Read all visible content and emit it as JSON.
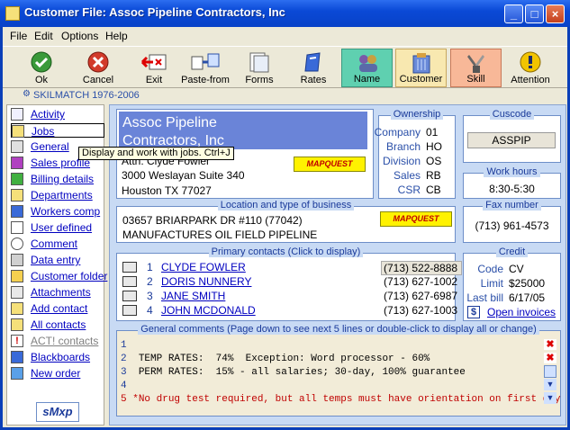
{
  "window": {
    "title": "Customer File:  Assoc Pipeline Contractors, Inc"
  },
  "menu": [
    "File",
    "Edit",
    "Options",
    "Help"
  ],
  "toolbar": [
    "Ok",
    "Cancel",
    "Exit",
    "Paste-from",
    "Forms",
    "Rates",
    "Name",
    "Customer",
    "Skill",
    "Attention"
  ],
  "skilmatch": "SKILMATCH 1976-2006",
  "sidebar": [
    "Activity",
    "Jobs",
    "General",
    "Sales profile",
    "Billing details",
    "Departments",
    "Workers comp",
    "User defined",
    "Comment",
    "Data entry",
    "Customer folder",
    "Attachments",
    "Add contact",
    "All contacts",
    "ACT! contacts",
    "Blackboards",
    "New order"
  ],
  "tooltip": "Display and work with jobs.   Ctrl+J",
  "company": {
    "name_line1": "Assoc Pipeline",
    "name_line2": "Contractors, Inc",
    "attn": "Attn: Clyde Fowler",
    "address": "3000 Weslayan Suite 340",
    "city": "Houston TX 77027",
    "mapquest": "MAPQUEST"
  },
  "ownership": {
    "title": "Ownership",
    "rows": [
      {
        "label": "Company",
        "value": "01"
      },
      {
        "label": "Branch",
        "value": "HO"
      },
      {
        "label": "Division",
        "value": "OS"
      },
      {
        "label": "Sales",
        "value": "RB"
      },
      {
        "label": "CSR",
        "value": "CB"
      }
    ]
  },
  "cuscode": {
    "title": "Cuscode",
    "value": "ASSPIP"
  },
  "workhours": {
    "title": "Work hours",
    "value": "8:30-5:30"
  },
  "location": {
    "title": "Location and type of business",
    "line1": "03657 BRIARPARK DR #110 (77042)",
    "line2": "MANUFACTURES OIL FIELD PIPELINE",
    "mapquest": "MAPQUEST"
  },
  "fax": {
    "title": "Fax number",
    "value": "(713) 961-4573"
  },
  "contacts": {
    "title": "Primary contacts (Click to display)",
    "rows": [
      {
        "num": "1",
        "name": "CLYDE FOWLER",
        "phone": "(713) 522-8888"
      },
      {
        "num": "2",
        "name": "DORIS NUNNERY",
        "phone": "(713) 627-1002"
      },
      {
        "num": "3",
        "name": "JANE SMITH",
        "phone": "(713) 627-6987"
      },
      {
        "num": "4",
        "name": "JOHN MCDONALD",
        "phone": "(713) 627-1003"
      }
    ]
  },
  "credit": {
    "title": "Credit",
    "code_label": "Code",
    "code": "CV",
    "limit_label": "Limit",
    "limit": "$25000",
    "lastbill_label": "Last bill",
    "lastbill": "6/17/05",
    "open_invoices": "Open invoices",
    "dollar": "$"
  },
  "comments": {
    "title": "General comments (Page down to see next 5 lines or double-click to display all or change)",
    "lines": [
      {
        "num": "1",
        "text": ""
      },
      {
        "num": "2",
        "text": "TEMP RATES:  74%  Exception: Word processor - 60%"
      },
      {
        "num": "3",
        "text": "PERM RATES:  15% - all salaries; 30-day, 100% guarantee"
      },
      {
        "num": "4",
        "text": ""
      },
      {
        "num": "5",
        "text": "*No drug test required, but all temps must have orientation on first day"
      }
    ]
  },
  "logo": "sMxp"
}
